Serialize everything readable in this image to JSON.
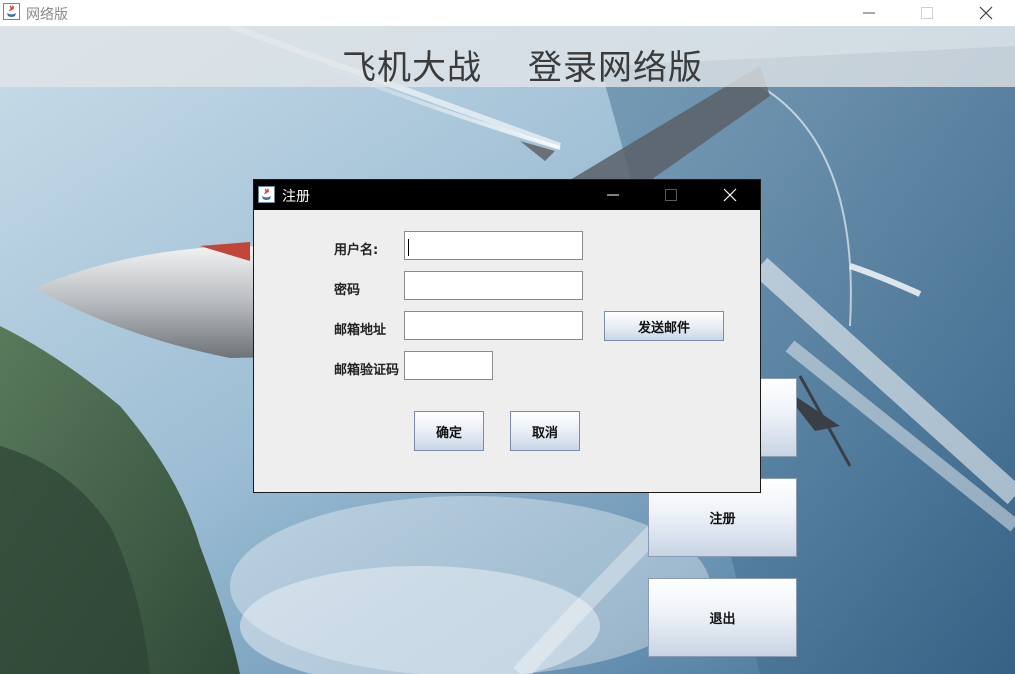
{
  "main_window": {
    "title": "网络版",
    "controls": {
      "minimize": "minimize",
      "maximize": "maximize",
      "close": "close"
    }
  },
  "banner": {
    "title_left": "飞机大战",
    "title_right": "登录网络版"
  },
  "side_buttons": {
    "register_label": "注册",
    "exit_label": "退出"
  },
  "dialog": {
    "title": "注册",
    "fields": {
      "username_label": "用户名:",
      "username_value": "",
      "password_label": "密码",
      "password_value": "",
      "email_label": "邮箱地址",
      "email_value": "",
      "code_label": "邮箱验证码",
      "code_value": ""
    },
    "send_email_label": "发送邮件",
    "confirm_label": "确定",
    "cancel_label": "取消"
  },
  "colors": {
    "dialog_title_bg": "#000000",
    "dialog_body_bg": "#eeeeee",
    "button_border": "#7a8ca6"
  },
  "icons": [
    "java-app-icon",
    "minimize-icon",
    "maximize-icon",
    "close-icon"
  ]
}
